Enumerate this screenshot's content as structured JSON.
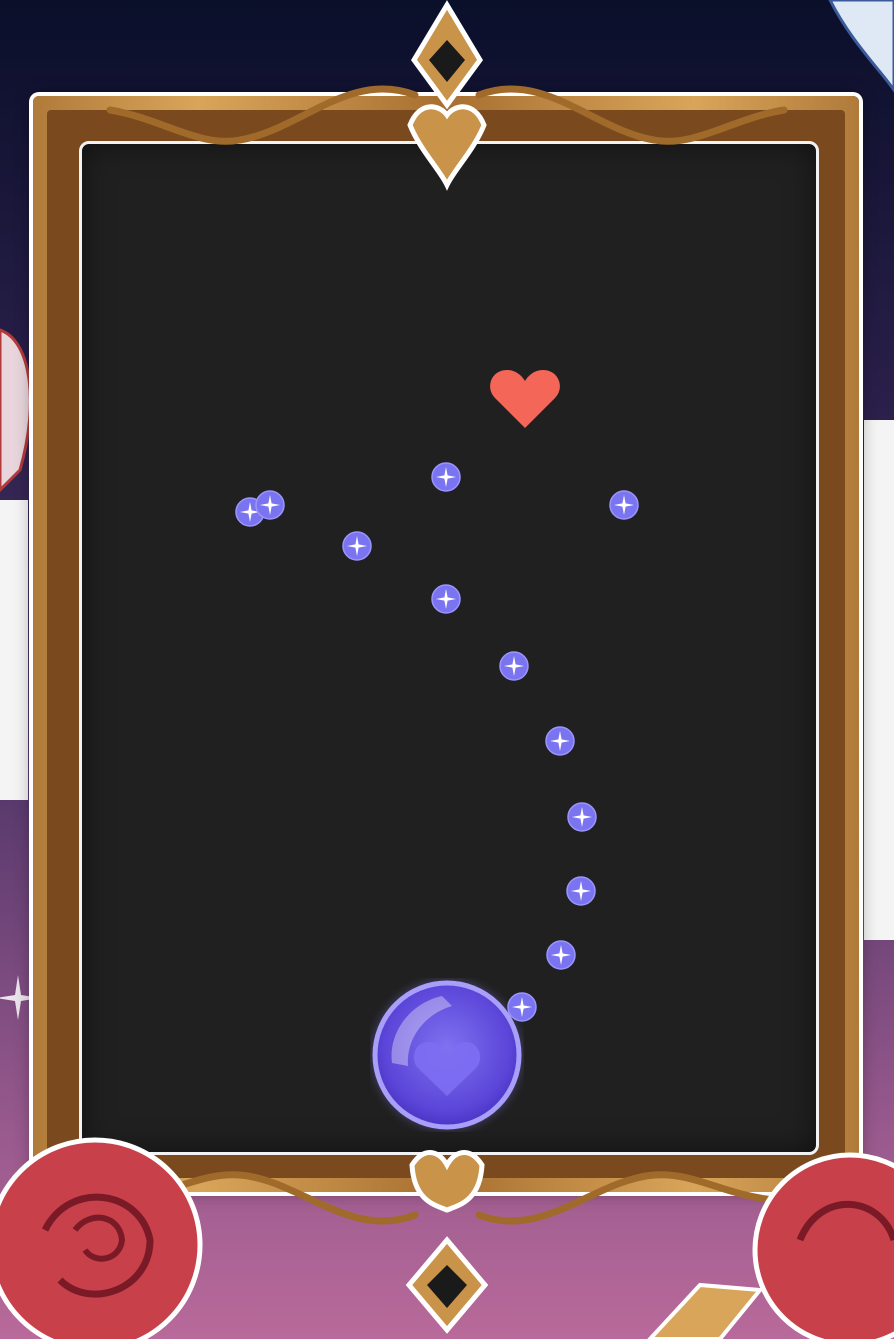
{
  "scene": {
    "goal_icon": "heart-icon",
    "player_icon": "heart-bubble-icon",
    "orb_icon": "sparkle-orb-icon",
    "orb_count": 13
  },
  "colors": {
    "goal": "#f36658",
    "orb": "#7b74f0",
    "player": "#6a58e0",
    "playfield": "#202020",
    "frame_gold": "#c9934a"
  }
}
